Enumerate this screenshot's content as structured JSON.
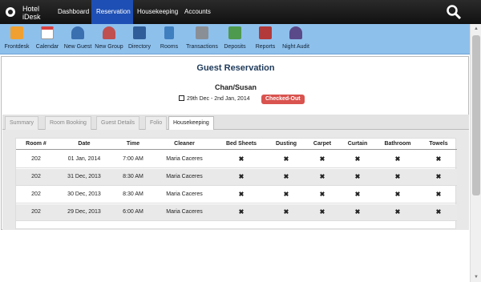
{
  "app": {
    "logo_line1": "Hotel",
    "logo_line2": "iDesk"
  },
  "nav": [
    {
      "label": "Dashboard"
    },
    {
      "label": "Reservation"
    },
    {
      "label": "Housekeeping"
    },
    {
      "label": "Accounts"
    }
  ],
  "toolbar": [
    {
      "label": "Frontdesk",
      "icon": "frontdesk-icon",
      "color": "#f0a030"
    },
    {
      "label": "Calendar",
      "icon": "calendar-icon",
      "color": "#d94040"
    },
    {
      "label": "New Guest",
      "icon": "new-guest-icon",
      "color": "#3a6fb0"
    },
    {
      "label": "New Group",
      "icon": "new-group-icon",
      "color": "#c05050"
    },
    {
      "label": "Directory",
      "icon": "directory-icon",
      "color": "#2f5d99"
    },
    {
      "label": "Rooms",
      "icon": "rooms-icon",
      "color": "#3f7fc0"
    },
    {
      "label": "Transactions",
      "icon": "transactions-icon",
      "color": "#8a8f96"
    },
    {
      "label": "Deposits",
      "icon": "deposits-icon",
      "color": "#4e9a4e"
    },
    {
      "label": "Reports",
      "icon": "reports-icon",
      "color": "#b23a3a"
    },
    {
      "label": "Night Audit",
      "icon": "night-audit-icon",
      "color": "#5a4a8a"
    }
  ],
  "page": {
    "title": "Guest Reservation",
    "guest_name": "Chan/Susan",
    "dates": "29th Dec - 2nd Jan, 2014",
    "status": "Checked-Out",
    "status_color": "#d9534f"
  },
  "tabs": [
    {
      "label": "Summary"
    },
    {
      "label": "Room Booking"
    },
    {
      "label": "Guest Details"
    },
    {
      "label": "Folio"
    },
    {
      "label": "Housekeeping"
    }
  ],
  "table": {
    "columns": [
      "Room #",
      "Date",
      "Time",
      "Cleaner",
      "Bed Sheets",
      "Dusting",
      "Carpet",
      "Curtain",
      "Bathroom",
      "Towels"
    ],
    "rows": [
      [
        "202",
        "01 Jan, 2014",
        "7:00 AM",
        "Maria Caceres",
        "✖",
        "✖",
        "✖",
        "✖",
        "✖",
        "✖"
      ],
      [
        "202",
        "31 Dec, 2013",
        "8:30 AM",
        "Maria Caceres",
        "✖",
        "✖",
        "✖",
        "✖",
        "✖",
        "✖"
      ],
      [
        "202",
        "30 Dec, 2013",
        "8:30 AM",
        "Maria Caceres",
        "✖",
        "✖",
        "✖",
        "✖",
        "✖",
        "✖"
      ],
      [
        "202",
        "29 Dec, 2013",
        "6:00 AM",
        "Maria Caceres",
        "✖",
        "✖",
        "✖",
        "✖",
        "✖",
        "✖"
      ]
    ]
  }
}
